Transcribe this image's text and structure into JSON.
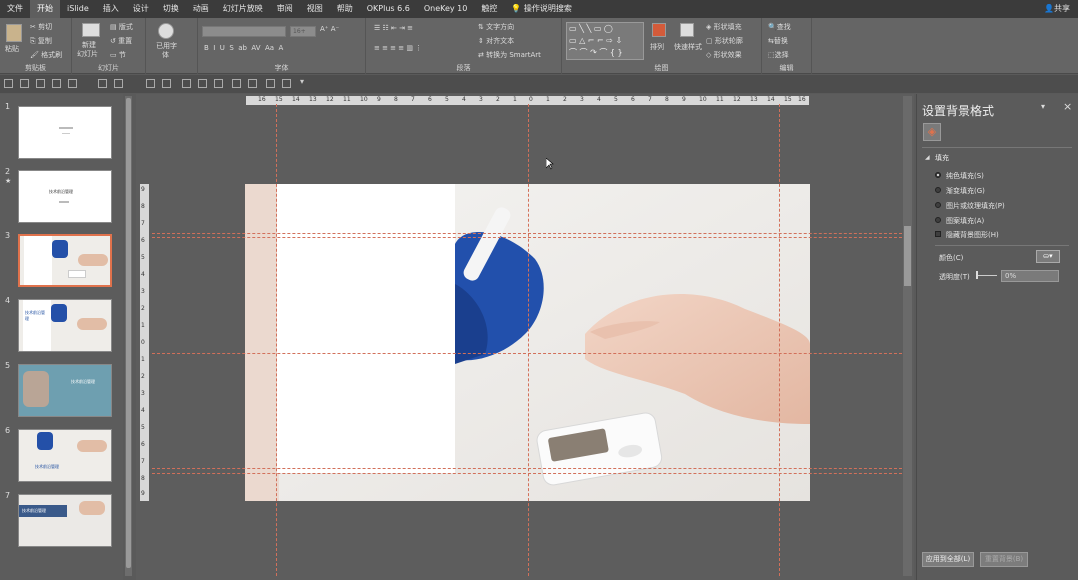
{
  "menu": {
    "items": [
      "文件",
      "开始",
      "iSlide",
      "插入",
      "设计",
      "切换",
      "动画",
      "幻灯片放映",
      "审阅",
      "视图",
      "帮助",
      "OKPlus 6.6",
      "OneKey 10",
      "触控",
      "操作说明搜索"
    ],
    "active": "开始",
    "share": "共享"
  },
  "ribbon": {
    "clipboard": {
      "label": "剪贴板",
      "paste": "粘贴",
      "cut": "剪切",
      "copy": "复制",
      "format_painter": "格式刷"
    },
    "slides": {
      "label": "幻灯片",
      "new_slide": "新建",
      "new_slide2": "幻灯片",
      "layout": "版式",
      "reset": "重置",
      "section": "节"
    },
    "font_grp": {
      "label": "字体",
      "used_font": "已用字",
      "used_font2": "体",
      "size": "16+"
    },
    "paragraph": {
      "label": "段落",
      "text_direction": "文字方向",
      "align_text": "对齐文本",
      "smartart": "转换为 SmartArt"
    },
    "drawing": {
      "label": "绘图",
      "arrange": "排列",
      "quick_styles": "快速样式",
      "shape_fill": "形状填充",
      "shape_outline": "形状轮廓",
      "shape_effects": "形状效果"
    },
    "editing": {
      "label": "编辑",
      "find": "查找",
      "replace": "替换",
      "select": "选择"
    }
  },
  "thumbnails": [
    {
      "num": "1",
      "title": ""
    },
    {
      "num": "2",
      "title": "技术前沿管理"
    },
    {
      "num": "3",
      "title": ""
    },
    {
      "num": "4",
      "title": "技术前沿管理"
    },
    {
      "num": "5",
      "title": "技术前沿管理"
    },
    {
      "num": "6",
      "title": "技术前沿管理"
    },
    {
      "num": "7",
      "title": "技术前沿管理"
    }
  ],
  "ruler": {
    "h_ticks": [
      "16",
      "15",
      "14",
      "13",
      "12",
      "11",
      "10",
      "9",
      "8",
      "7",
      "6",
      "5",
      "4",
      "3",
      "2",
      "1",
      "0",
      "1",
      "2",
      "3",
      "4",
      "5",
      "6",
      "7",
      "8",
      "9",
      "10",
      "11",
      "12",
      "13",
      "14",
      "15",
      "16"
    ],
    "v_ticks": [
      "9",
      "8",
      "7",
      "6",
      "5",
      "4",
      "3",
      "2",
      "1",
      "0",
      "1",
      "2",
      "3",
      "4",
      "5",
      "6",
      "7",
      "8",
      "9"
    ]
  },
  "panel": {
    "title": "设置背景格式",
    "section": "填充",
    "options": [
      {
        "label": "纯色填充(S)",
        "selected": true
      },
      {
        "label": "渐变填充(G)",
        "selected": false
      },
      {
        "label": "图片或纹理填充(P)",
        "selected": false
      },
      {
        "label": "图案填充(A)",
        "selected": false
      }
    ],
    "hide_bg": "隐藏背景图形(H)",
    "color_label": "颜色(C)",
    "transparency_label": "透明度(T)",
    "transparency_value": "0%",
    "apply_all": "应用到全部(L)",
    "reset_bg": "重置背景(B)"
  },
  "colors": {
    "accent": "#e0724c",
    "guide": "#d2705a",
    "dark_bg": "#5a5a5a",
    "glove": "#1e4aa8"
  }
}
